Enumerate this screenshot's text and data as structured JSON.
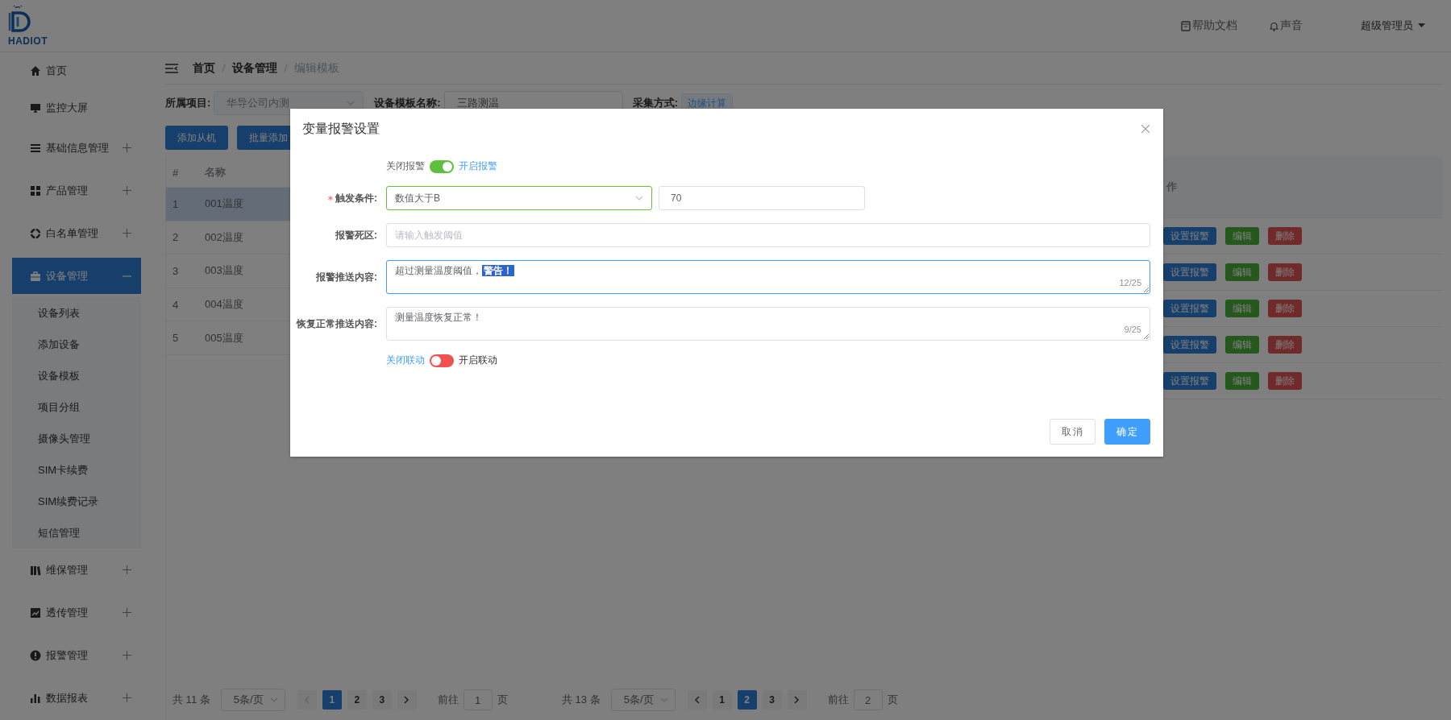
{
  "logo": {
    "text": "HADIOT"
  },
  "header": {
    "help": "帮助文档",
    "sound": "声音",
    "user": "超级管理员"
  },
  "sidebar": {
    "items": [
      {
        "label": "首页",
        "kind": "link",
        "selected": false
      },
      {
        "label": "监控大屏",
        "kind": "link",
        "selected": false
      },
      {
        "label": "基础信息管理",
        "kind": "group",
        "selected": false,
        "expanded": false
      },
      {
        "label": "产品管理",
        "kind": "group",
        "selected": false,
        "expanded": false
      },
      {
        "label": "白名单管理",
        "kind": "group",
        "selected": false,
        "expanded": false
      },
      {
        "label": "设备管理",
        "kind": "group",
        "selected": true,
        "expanded": true,
        "children": [
          {
            "label": "设备列表"
          },
          {
            "label": "添加设备"
          },
          {
            "label": "设备模板"
          },
          {
            "label": "项目分组"
          },
          {
            "label": "摄像头管理"
          },
          {
            "label": "SIM卡续费"
          },
          {
            "label": "SIM续费记录"
          },
          {
            "label": "短信管理"
          }
        ]
      },
      {
        "label": "维保管理",
        "kind": "group",
        "selected": false,
        "expanded": false
      },
      {
        "label": "透传管理",
        "kind": "group",
        "selected": false,
        "expanded": false
      },
      {
        "label": "报警管理",
        "kind": "group",
        "selected": false,
        "expanded": false
      },
      {
        "label": "数据报表",
        "kind": "group",
        "selected": false,
        "expanded": false
      }
    ]
  },
  "breadcrumb": [
    {
      "label": "首页",
      "current": false
    },
    {
      "label": "设备管理",
      "current": false
    },
    {
      "label": "编辑模板",
      "current": true
    }
  ],
  "template_form": [
    {
      "label": "所属项目:",
      "kind": "select",
      "value": "华导公司内测",
      "disabled": true
    },
    {
      "label": "设备模板名称:",
      "kind": "input",
      "value": "三路测温",
      "disabled": false
    },
    {
      "label": "采集方式:",
      "kind": "tag",
      "value": "边缘计算",
      "disabled": false
    }
  ],
  "toolbar_buttons": [
    "添加从机",
    "批量添加"
  ],
  "left_table": {
    "columns": [
      "#",
      "名称"
    ],
    "rows": [
      {
        "cells": [
          "1",
          "001温度"
        ],
        "highlighted": true
      },
      {
        "cells": [
          "2",
          "002温度"
        ],
        "highlighted": false
      },
      {
        "cells": [
          "3",
          "003温度"
        ],
        "highlighted": false
      },
      {
        "cells": [
          "4",
          "004温度"
        ],
        "highlighted": false
      },
      {
        "cells": [
          "5",
          "005温度"
        ],
        "highlighted": false
      }
    ],
    "pagination": {
      "total": "共 11 条",
      "page_size": "5条/页",
      "prev_disabled": true,
      "pages": [
        {
          "label": "1",
          "selected": true
        },
        {
          "label": "2",
          "selected": false
        },
        {
          "label": "3",
          "selected": false
        }
      ],
      "goto_label": "前往",
      "goto_value": "1",
      "page_suffix": "页"
    }
  },
  "right_table": {
    "columns": [
      "作"
    ],
    "rows": [
      {
        "actions": [
          {
            "label": "设置报警",
            "kind": "primary"
          },
          {
            "label": "编辑",
            "kind": "success"
          },
          {
            "label": "删除",
            "kind": "danger"
          }
        ]
      },
      {
        "actions": [
          {
            "label": "设置报警",
            "kind": "primary"
          },
          {
            "label": "编辑",
            "kind": "success"
          },
          {
            "label": "删除",
            "kind": "danger"
          }
        ]
      },
      {
        "actions": [
          {
            "label": "设置报警",
            "kind": "primary"
          },
          {
            "label": "编辑",
            "kind": "success"
          },
          {
            "label": "删除",
            "kind": "danger"
          }
        ]
      },
      {
        "actions": [
          {
            "label": "设置报警",
            "kind": "primary"
          },
          {
            "label": "编辑",
            "kind": "success"
          },
          {
            "label": "删除",
            "kind": "danger"
          }
        ]
      },
      {
        "actions": [
          {
            "label": "设置报警",
            "kind": "primary"
          },
          {
            "label": "编辑",
            "kind": "success"
          },
          {
            "label": "删除",
            "kind": "danger"
          }
        ]
      }
    ],
    "pagination": {
      "total": "共 13 条",
      "page_size": "5条/页",
      "prev_disabled": false,
      "pages": [
        {
          "label": "1",
          "selected": false
        },
        {
          "label": "2",
          "selected": true
        },
        {
          "label": "3",
          "selected": false
        }
      ],
      "goto_label": "前往",
      "goto_value": "2",
      "page_suffix": "页"
    }
  },
  "dialog": {
    "title": "变量报警设置",
    "alarm_switch": {
      "off_label": "关闭报警",
      "on_label": "开启报警",
      "on": true
    },
    "trigger": {
      "label": "触发条件:",
      "required": true,
      "condition": "数值大于B",
      "validated": true,
      "threshold": "70"
    },
    "deadband": {
      "label": "报警死区:",
      "placeholder": "请输入触发阈值"
    },
    "alarm_message": {
      "label": "报警推送内容:",
      "text": "超过测量温度阈值，",
      "selected_text": "警告！",
      "counter": "12/25",
      "focused": true
    },
    "recovery_message": {
      "label": "恢复正常推送内容:",
      "text": "测量温度恢复正常！",
      "counter": "9/25",
      "focused": false
    },
    "linkage_switch": {
      "off_label": "关闭联动",
      "on_label": "开启联动",
      "on": false
    },
    "buttons": [
      {
        "label": "取消",
        "kind": "default"
      },
      {
        "label": "确定",
        "kind": "primary"
      }
    ]
  }
}
